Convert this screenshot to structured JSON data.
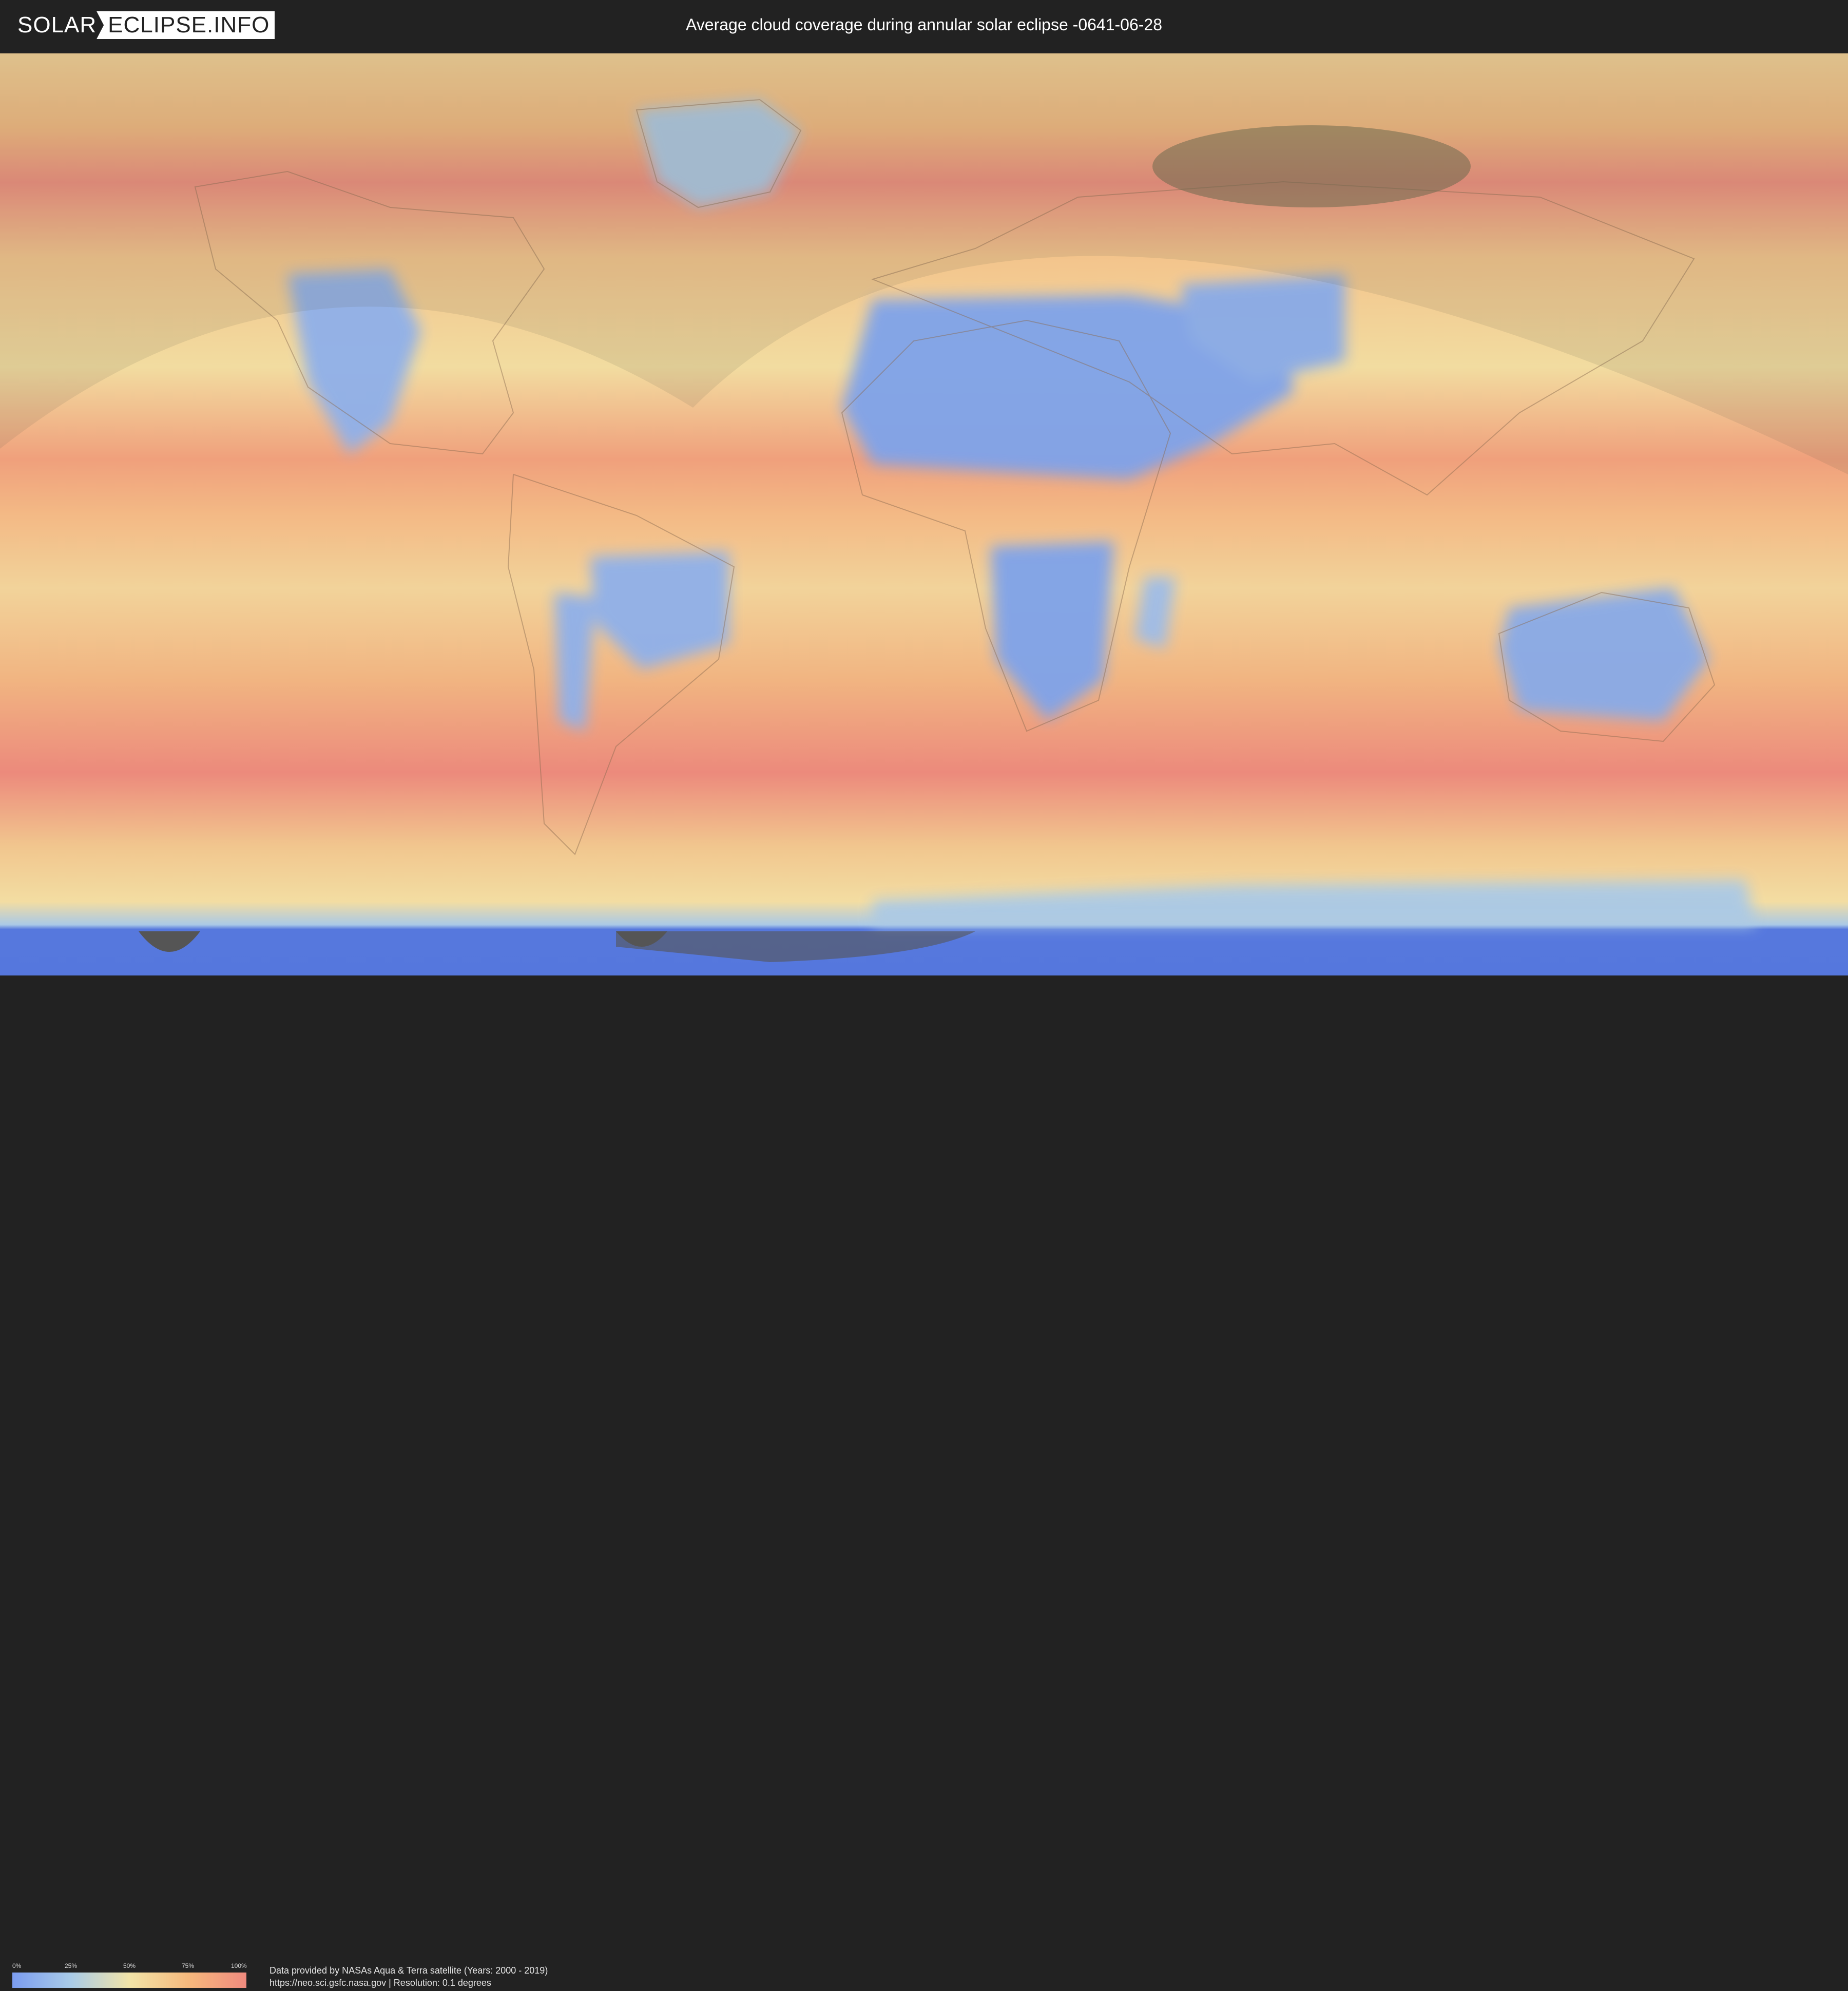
{
  "header": {
    "logo_solar": "SOLAR",
    "logo_eclipse": "ECLIPSE.INFO",
    "title": "Average cloud coverage during annular solar eclipse -0641-06-28"
  },
  "legend": {
    "ticks": [
      "0%",
      "25%",
      "50%",
      "75%",
      "100%"
    ],
    "colors": [
      "#7b9cf0",
      "#a9cbe8",
      "#f2e4a8",
      "#f6b97d",
      "#f08a7e"
    ]
  },
  "footer": {
    "credit_line1": "Data provided by NASAs Aqua & Terra satellite (Years: 2000 - 2019)",
    "credit_line2": "https://neo.sci.gsfc.nasa.gov | Resolution: 0.1 degrees"
  },
  "map": {
    "colors": {
      "clear": "#7fa3ea",
      "low": "#aac9e6",
      "mid": "#f1dfa0",
      "high": "#f5b27a",
      "overcast": "#ec8a7c",
      "ocean_polar": "#5577dd",
      "eclipse_shadow": "#6e6a4e",
      "night_band": "#555555"
    }
  }
}
